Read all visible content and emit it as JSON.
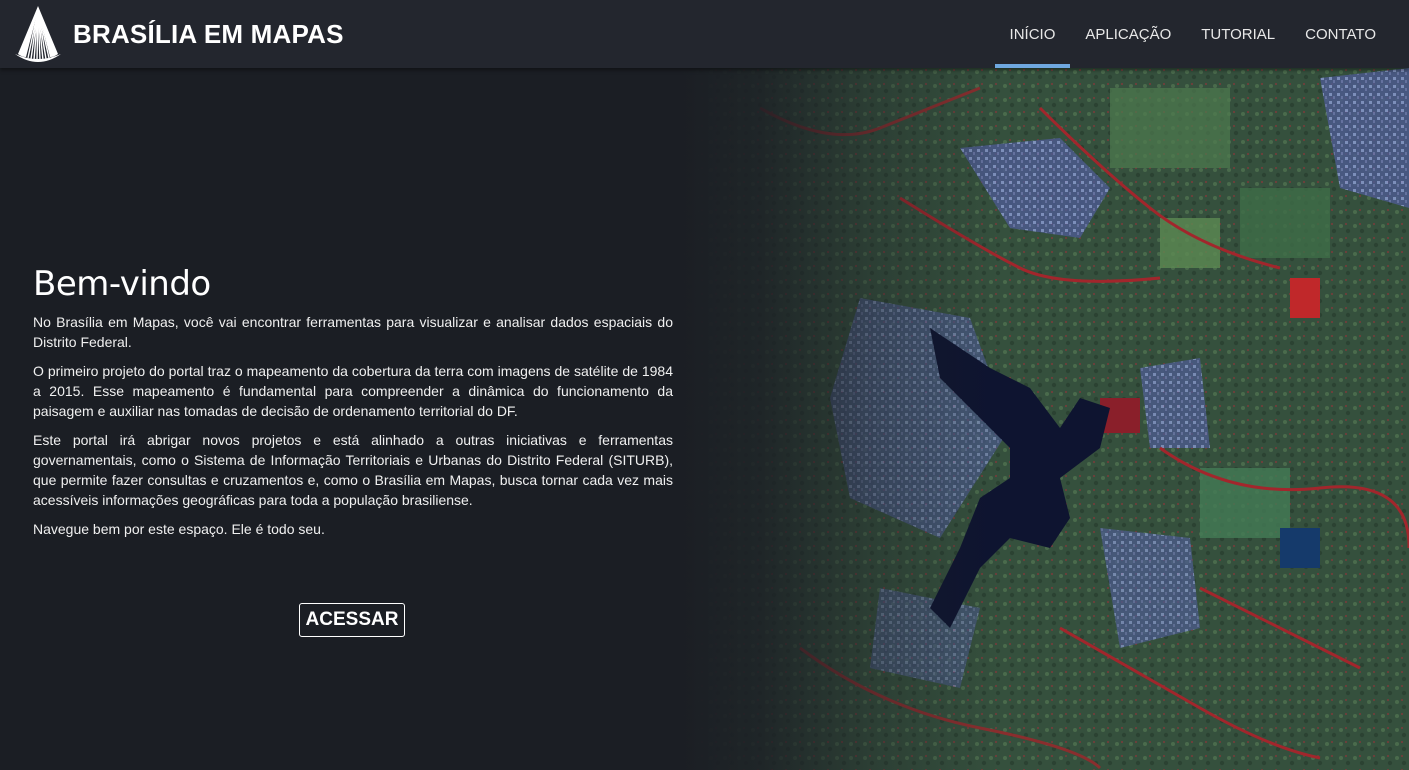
{
  "header": {
    "brand_name": "BRASÍLIA EM MAPAS",
    "logo_icon": "brasilia-cathedral-logo-icon",
    "nav": [
      {
        "label": "INÍCIO",
        "active": true
      },
      {
        "label": "APLICAÇÃO",
        "active": false
      },
      {
        "label": "TUTORIAL",
        "active": false
      },
      {
        "label": "CONTATO",
        "active": false
      }
    ],
    "active_color": "#6fa8e0"
  },
  "main": {
    "title": "Bem-vindo",
    "paragraphs": [
      "No Brasília em Mapas, você vai encontrar ferramentas para visualizar e analisar dados espaciais do Distrito Federal.",
      "O primeiro projeto do portal traz o mapeamento da cobertura da terra com imagens de satélite de 1984 a 2015. Esse mapeamento é fundamental para compreender a dinâmica do funcionamento da paisagem e auxiliar nas tomadas de decisão de ordenamento territorial do DF.",
      "Este portal irá abrigar novos projetos e está alinhado a outras iniciativas e ferramentas governamentais, como o Sistema de Informação Territoriais e Urbanas do Distrito Federal (SITURB), que permite fazer consultas e cruzamentos e, como o Brasília em Mapas, busca tornar cada vez mais acessíveis informações geográficas para toda a população brasiliense.",
      "Navegue bem por este espaço. Ele é todo seu."
    ],
    "cta_label": "ACESSAR"
  },
  "colors": {
    "background": "#1b1e24",
    "navbar": "#23262e"
  }
}
